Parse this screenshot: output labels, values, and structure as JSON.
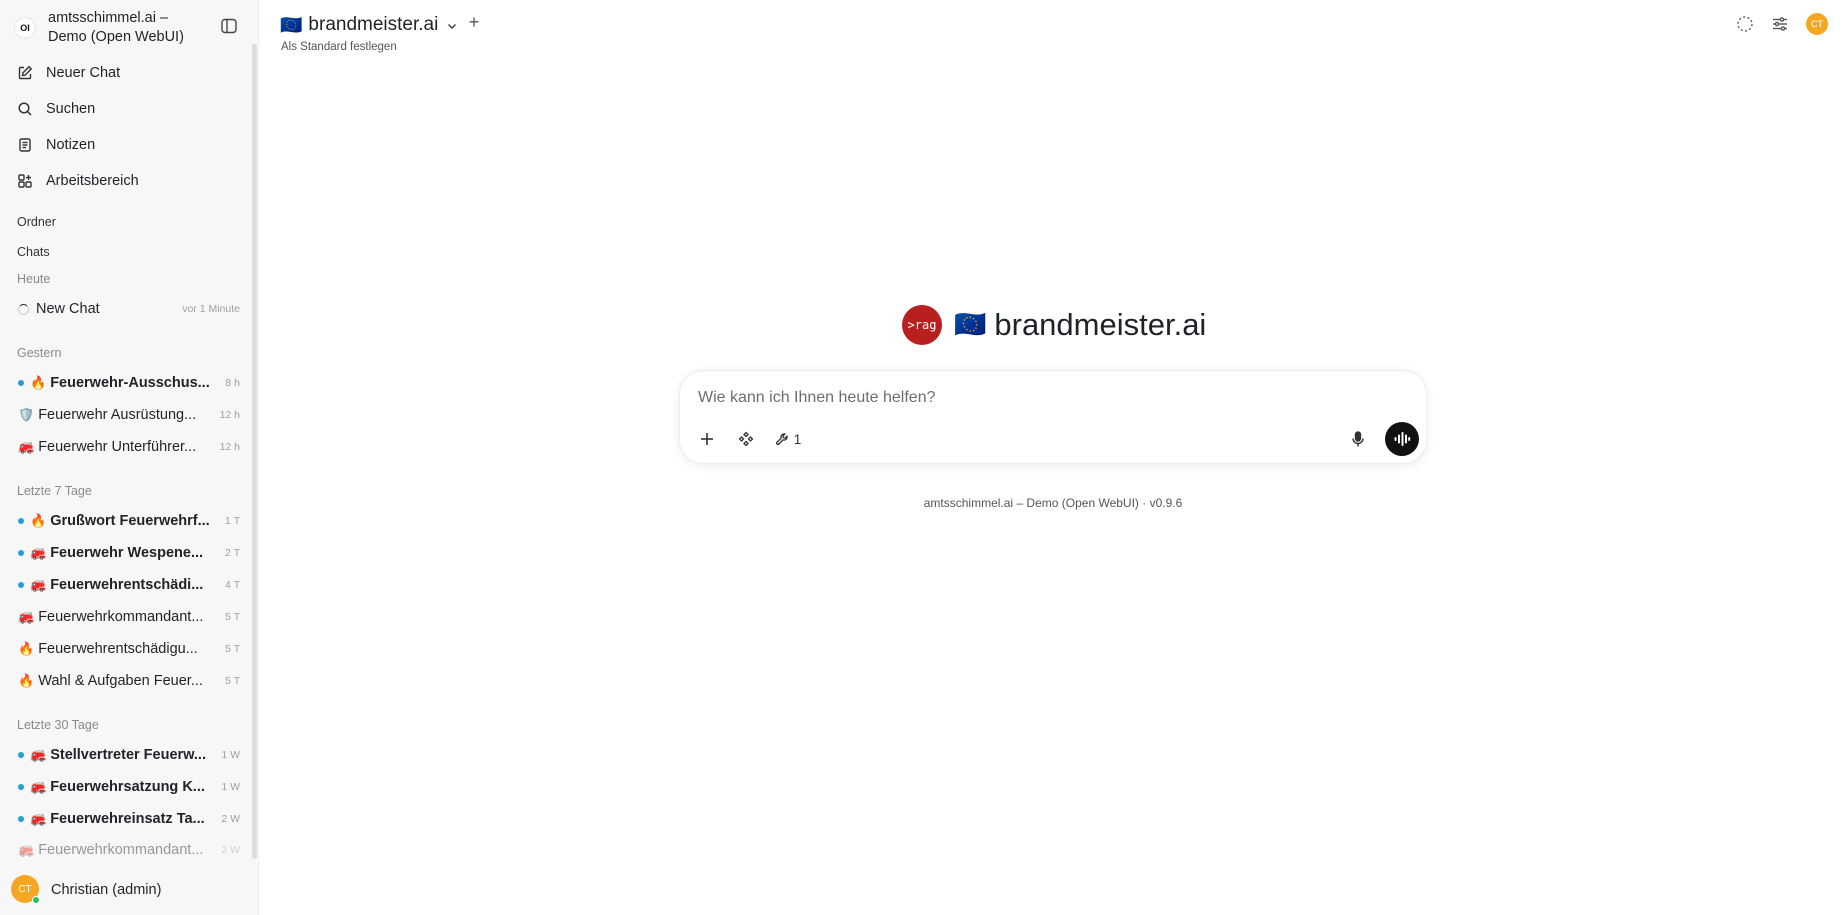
{
  "app": {
    "title": "amtsschimmel.ai – Demo (Open WebUI)",
    "logo_text": "OI"
  },
  "sidebar": {
    "nav": [
      {
        "label": "Neuer Chat",
        "icon": "edit-icon"
      },
      {
        "label": "Suchen",
        "icon": "search-icon"
      },
      {
        "label": "Notizen",
        "icon": "notes-icon"
      },
      {
        "label": "Arbeitsbereich",
        "icon": "workspace-icon"
      }
    ],
    "folders_label": "Ordner",
    "chats_label": "Chats",
    "groups": [
      {
        "label": "Heute",
        "chats": [
          {
            "title": "New Chat",
            "time": "vor 1 Minute",
            "emoji": "",
            "unread": false,
            "loading": true
          }
        ]
      },
      {
        "label": "Gestern",
        "chats": [
          {
            "title": "Feuerwehr-Ausschus...",
            "time": "8 h",
            "emoji": "🔥",
            "unread": true
          },
          {
            "title": "Feuerwehr Ausrüstung...",
            "time": "12 h",
            "emoji": "🛡️",
            "unread": false
          },
          {
            "title": "Feuerwehr Unterführer...",
            "time": "12 h",
            "emoji": "🚒",
            "unread": false
          }
        ]
      },
      {
        "label": "Letzte 7 Tage",
        "chats": [
          {
            "title": "Grußwort Feuerwehrf...",
            "time": "1 T",
            "emoji": "🔥",
            "unread": true
          },
          {
            "title": "Feuerwehr Wespene...",
            "time": "2 T",
            "emoji": "🚒",
            "unread": true
          },
          {
            "title": "Feuerwehrentschädi...",
            "time": "4 T",
            "emoji": "🚒",
            "unread": true
          },
          {
            "title": "Feuerwehrkommandant...",
            "time": "5 T",
            "emoji": "🚒",
            "unread": false
          },
          {
            "title": "Feuerwehrentschädigu...",
            "time": "5 T",
            "emoji": "🔥",
            "unread": false
          },
          {
            "title": "Wahl & Aufgaben Feuer...",
            "time": "5 T",
            "emoji": "🔥",
            "unread": false
          }
        ]
      },
      {
        "label": "Letzte 30 Tage",
        "chats": [
          {
            "title": "Stellvertreter Feuerw...",
            "time": "1 W",
            "emoji": "🚒",
            "unread": true
          },
          {
            "title": "Feuerwehrsatzung K...",
            "time": "1 W",
            "emoji": "🚒",
            "unread": true
          },
          {
            "title": "Feuerwehreinsatz Ta...",
            "time": "2 W",
            "emoji": "🚒",
            "unread": true
          },
          {
            "title": "Feuerwehrkommandant...",
            "time": "2 W",
            "emoji": "🚒",
            "unread": false
          }
        ]
      }
    ],
    "user": {
      "initials": "CT",
      "name": "Christian (admin)",
      "status_color": "#22c55e"
    }
  },
  "topbar": {
    "model_flag": "🇪🇺",
    "model_name": "brandmeister.ai",
    "set_default": "Als Standard festlegen",
    "add_icon": "+",
    "icons": [
      "loading-icon",
      "controls-icon"
    ],
    "avatar_initials": "CT"
  },
  "main": {
    "model_avatar_text": ">rag",
    "model_flag": "🇪🇺",
    "model_name": "brandmeister.ai",
    "prompt_placeholder": "Wie kann ich Ihnen heute helfen?",
    "tools_count": "1",
    "footer": "amtsschimmel.ai – Demo (Open WebUI) · v0.9.6"
  },
  "colors": {
    "accent_orange": "#f5a623",
    "unread_dot": "#2b9bd6",
    "model_avatar_bg": "#b81f1f",
    "sidebar_bg": "#f7f7f8"
  }
}
